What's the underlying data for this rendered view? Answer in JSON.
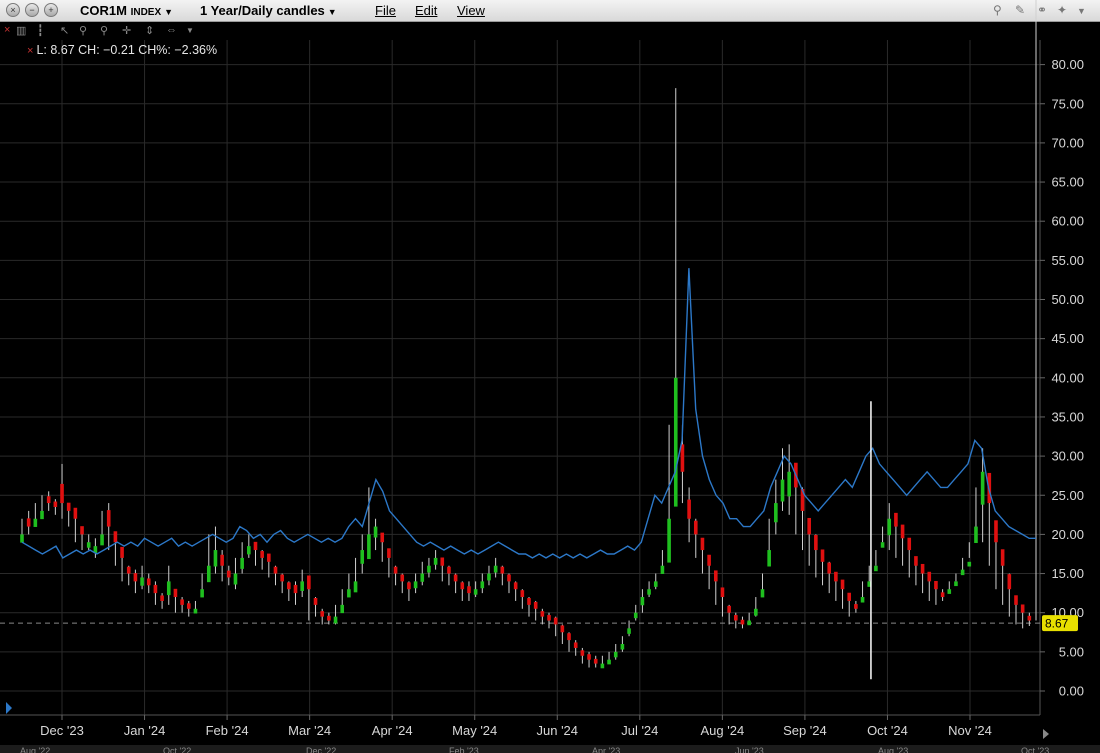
{
  "titlebar": {
    "symbol": "COR1M",
    "symbol_suffix": "INDEX",
    "period": "1 Year/Daily candles",
    "menus": [
      "File",
      "Edit",
      "View"
    ],
    "window_buttons": [
      "close-icon",
      "minimize-icon",
      "zoom-icon"
    ],
    "right_tools": [
      "search-icon",
      "wrench-icon",
      "link-icon",
      "pin-icon",
      "dropdown-icon"
    ]
  },
  "toolbar": {
    "tools": [
      "close-icon",
      "bar-chart-icon",
      "candle-icon",
      "pointer-icon",
      "zoom-in-icon",
      "zoom-out-icon",
      "crosshair-icon",
      "pan-vertical-icon",
      "pan-horizontal-icon",
      "dropdown-icon"
    ]
  },
  "readout": {
    "text": "L: 8.67  CH: −0.21  CH%: −2.36%"
  },
  "colors": {
    "background": "#000000",
    "grid": "#2a2a2a",
    "up": "#1fbf1f",
    "down": "#e01010",
    "overlay_line": "#2c78c8",
    "last_price_tag": "#e8e000",
    "spike_line": "#ffffff"
  },
  "chart_data": {
    "type": "candlestick",
    "title": "",
    "ylim": [
      0,
      80
    ],
    "y_ticks": [
      "0.00",
      "5.00",
      "10.00",
      "15.00",
      "20.00",
      "25.00",
      "30.00",
      "35.00",
      "40.00",
      "45.00",
      "50.00",
      "55.00",
      "60.00",
      "65.00",
      "70.00",
      "75.00",
      "80.00"
    ],
    "x_labels": [
      "Dec '23",
      "Jan '24",
      "Feb '24",
      "Mar '24",
      "Apr '24",
      "May '24",
      "Jun '24",
      "Jul '24",
      "Aug '24",
      "Sep '24",
      "Oct '24",
      "Nov '24"
    ],
    "last_value": "8.67",
    "reference_level": 8.67,
    "candle_series": {
      "name": "COR1M",
      "close": [
        20,
        21,
        22,
        23,
        24,
        23.5,
        24,
        23,
        22,
        20,
        19,
        18.5,
        20,
        21,
        19,
        17,
        15,
        14,
        14.5,
        13.5,
        12.5,
        11.5,
        14,
        12,
        11,
        10.5,
        10.5,
        13,
        16,
        18,
        16,
        14.5,
        15,
        17,
        18.5,
        18,
        17,
        16.5,
        15,
        14,
        13,
        12.5,
        14,
        13,
        11,
        9.5,
        9,
        9.5,
        11,
        13,
        14,
        18,
        20,
        21,
        19,
        17,
        15,
        14,
        13,
        14,
        15,
        16,
        17,
        16,
        15,
        14,
        13,
        12.5,
        13,
        14,
        15,
        16,
        15,
        14,
        13,
        12,
        11,
        10.5,
        9.5,
        9,
        8.5,
        7.5,
        6.5,
        5.5,
        4.5,
        4,
        3.5,
        3.5,
        4,
        5,
        6,
        8,
        10,
        12,
        13,
        14,
        16,
        22,
        40,
        28,
        22,
        20,
        18,
        16,
        14,
        12,
        10,
        9,
        8.5,
        9,
        10.5,
        13,
        18,
        24,
        27,
        28,
        26,
        23,
        20,
        18,
        16.5,
        15,
        14,
        13,
        11.5,
        10.5,
        12,
        14,
        16,
        19,
        22,
        21,
        19.5,
        18,
        16,
        15,
        14,
        13,
        12,
        13,
        14,
        15.5,
        16.5,
        21,
        28,
        24,
        19,
        16,
        13,
        11,
        10,
        9,
        8.67
      ],
      "high": [
        22,
        23,
        24,
        25,
        25.5,
        24.5,
        29,
        24,
        23,
        21,
        20,
        19.5,
        23,
        24,
        20,
        18,
        16,
        15.5,
        16,
        15,
        14,
        12.5,
        16,
        13,
        12,
        11.5,
        11.5,
        15,
        20,
        21,
        18,
        16,
        17,
        19,
        20,
        19,
        18,
        17.5,
        16,
        15,
        14,
        14,
        15.5,
        14,
        12,
        10.5,
        10,
        11,
        13,
        15,
        17,
        20,
        26,
        22,
        20,
        18,
        16,
        15,
        14,
        15,
        16.5,
        17,
        18,
        17,
        16,
        15,
        14,
        14,
        14,
        15,
        16,
        17,
        16,
        15,
        14,
        13,
        12,
        11.5,
        10.5,
        10,
        9.5,
        8.5,
        7.5,
        6.5,
        5.5,
        5,
        4.5,
        4.5,
        5,
        6,
        7,
        9,
        11,
        13,
        14,
        15,
        18,
        34,
        77,
        34,
        26,
        22,
        19.5,
        17,
        15,
        13,
        11,
        10,
        9.5,
        10,
        12,
        15,
        22,
        27,
        31,
        31.5,
        29,
        26,
        22,
        20,
        18,
        16.5,
        15,
        14,
        12.5,
        11.5,
        14,
        16,
        18,
        21,
        24,
        22,
        21,
        19,
        17,
        16,
        15,
        14,
        13,
        14,
        15,
        17,
        17,
        26,
        31,
        27,
        21,
        17,
        15,
        12,
        11,
        10,
        9
      ],
      "low": [
        19,
        20,
        21,
        22,
        23,
        22.5,
        22,
        21,
        19,
        18,
        18,
        17,
        19,
        18,
        16,
        14,
        13.5,
        12.5,
        13,
        12.5,
        11,
        10.5,
        11,
        10,
        10,
        9.5,
        10,
        12,
        14,
        15,
        14,
        13.5,
        13,
        15,
        17,
        16,
        15.5,
        14.5,
        13.5,
        12.5,
        11.5,
        11,
        12,
        9,
        9.5,
        8.5,
        8.5,
        8.5,
        10,
        12,
        13,
        15,
        17,
        18,
        16.5,
        14.5,
        13.5,
        12.5,
        11.5,
        12.5,
        13.5,
        14.5,
        15.5,
        14,
        13.5,
        12.5,
        11.5,
        11.5,
        12,
        12.5,
        13.5,
        14.5,
        13.5,
        12.5,
        11.5,
        10.5,
        9.5,
        9,
        8.5,
        8,
        7,
        6,
        5,
        4.5,
        3.5,
        3,
        3,
        3,
        3.5,
        4,
        5,
        7,
        9,
        10,
        12,
        13,
        15,
        18,
        30,
        24,
        19,
        17,
        15,
        13,
        11,
        9.5,
        8.5,
        8,
        8,
        8.5,
        9.5,
        12,
        16,
        20,
        23,
        22.5,
        20,
        18,
        16,
        14.5,
        13.5,
        12.5,
        11.5,
        10.5,
        9.5,
        10,
        12,
        14,
        16,
        19,
        18,
        17,
        16,
        14.5,
        13.5,
        12.5,
        11.5,
        11,
        11.5,
        12.5,
        14,
        15,
        19,
        20,
        19,
        16,
        13,
        11,
        9.5,
        8.5,
        8,
        8.3
      ],
      "direction": [
        1,
        -1,
        1,
        1,
        -1,
        -1,
        -1,
        -1,
        -1,
        -1,
        1,
        1,
        1,
        -1,
        -1,
        -1,
        -1,
        -1,
        1,
        -1,
        -1,
        -1,
        1,
        -1,
        -1,
        -1,
        1,
        1,
        1,
        1,
        -1,
        -1,
        1,
        1,
        1,
        -1,
        -1,
        -1,
        -1,
        -1,
        -1,
        -1,
        1,
        -1,
        -1,
        -1,
        -1,
        1,
        1,
        1,
        1,
        1,
        1,
        1,
        -1,
        -1,
        -1,
        -1,
        -1,
        1,
        1,
        1,
        1,
        -1,
        -1,
        -1,
        -1,
        -1,
        1,
        1,
        1,
        1,
        -1,
        -1,
        -1,
        -1,
        -1,
        -1,
        -1,
        -1,
        -1,
        -1,
        -1,
        -1,
        -1,
        -1,
        -1,
        1,
        1,
        1,
        1,
        1,
        1,
        1,
        1,
        1,
        1,
        1,
        1,
        -1,
        -1,
        -1,
        -1,
        -1,
        -1,
        -1,
        -1,
        -1,
        -1,
        1,
        1,
        1,
        1,
        1,
        1,
        1,
        -1,
        -1,
        -1,
        -1,
        -1,
        -1,
        -1,
        -1,
        -1,
        -1,
        1,
        1,
        1,
        1,
        1,
        -1,
        -1,
        -1,
        -1,
        -1,
        -1,
        -1,
        -1,
        1,
        1,
        1,
        1,
        1,
        1,
        -1,
        -1,
        -1,
        -1,
        -1,
        -1,
        -1,
        -1,
        -1
      ]
    },
    "overlay_series": {
      "name": "",
      "values": [
        19,
        18.5,
        18,
        17.5,
        18,
        18.5,
        17,
        17.5,
        18,
        17.5,
        18,
        17.5,
        18,
        18.5,
        19,
        18.5,
        19,
        18.5,
        19.5,
        19,
        18.5,
        19,
        19.5,
        18.5,
        19,
        18.5,
        19,
        19.5,
        20,
        19.5,
        19,
        19.5,
        21,
        20.5,
        19.5,
        20,
        19,
        20,
        20.5,
        19.5,
        19,
        19.5,
        20,
        19.5,
        19,
        19.5,
        19,
        19.5,
        21,
        22,
        21,
        24,
        27,
        25.5,
        23,
        22,
        21,
        20,
        19,
        18.5,
        19,
        18.5,
        18,
        18.5,
        18,
        17.5,
        18,
        17.5,
        18,
        18.5,
        19,
        18.5,
        18,
        17.5,
        17.5,
        17,
        17.5,
        17,
        17.5,
        17,
        17.5,
        17,
        17.5,
        17,
        17.5,
        18,
        17.5,
        17.5,
        18,
        18.5,
        18,
        19,
        22,
        25,
        24,
        26,
        28,
        32,
        54,
        36,
        30,
        27,
        25,
        24,
        22,
        22,
        21,
        21,
        22,
        23,
        26,
        28,
        30,
        29,
        27,
        25,
        24,
        23,
        24,
        25,
        26,
        27,
        26,
        28,
        30,
        31,
        29,
        28,
        27,
        26,
        25,
        26,
        27,
        28,
        27,
        26,
        26,
        27,
        28,
        29,
        32,
        31,
        26,
        23,
        22,
        21,
        20.5,
        20,
        19.5,
        19.5
      ]
    },
    "spike_line": {
      "high": 37,
      "low": 1.5
    }
  },
  "footer": {
    "strip_labels": [
      "Aug '22",
      "Oct '22",
      "Dec '22",
      "Feb '23",
      "Apr '23",
      "Jun '23",
      "Aug '23",
      "Oct '23"
    ]
  }
}
